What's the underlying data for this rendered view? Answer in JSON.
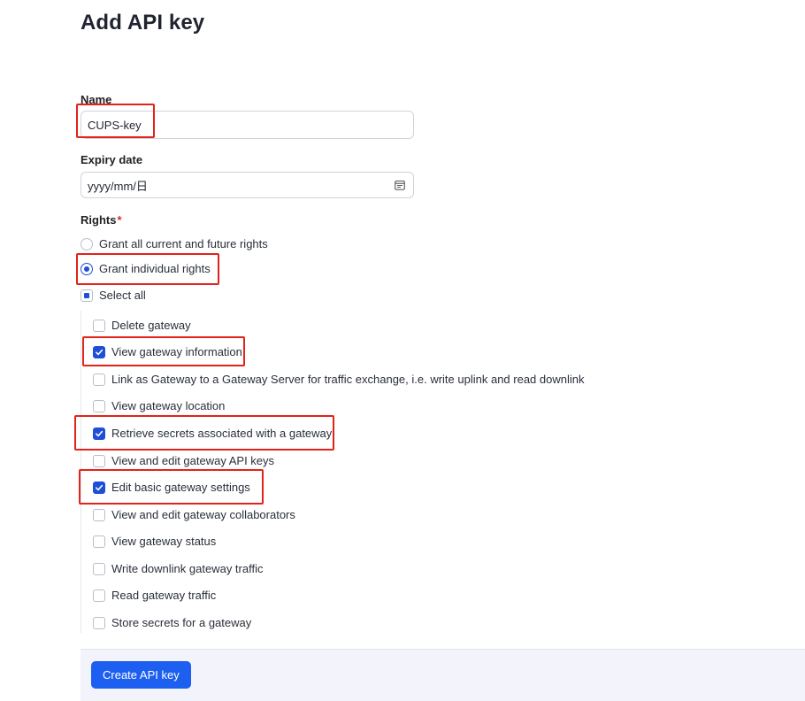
{
  "page": {
    "title": "Add API key"
  },
  "name_field": {
    "label": "Name",
    "value": "CUPS-key"
  },
  "expiry_field": {
    "label": "Expiry date",
    "placeholder": "yyyy/mm/日",
    "icon": "calendar-icon"
  },
  "rights": {
    "label": "Rights",
    "required_marker": "*",
    "options": [
      {
        "label": "Grant all current and future rights",
        "selected": false
      },
      {
        "label": "Grant individual rights",
        "selected": true
      }
    ],
    "select_all": {
      "label": "Select all",
      "state": "indeterminate"
    },
    "items": [
      {
        "label": "Delete gateway",
        "checked": false
      },
      {
        "label": "View gateway information",
        "checked": true
      },
      {
        "label": "Link as Gateway to a Gateway Server for traffic exchange, i.e. write uplink and read downlink",
        "checked": false
      },
      {
        "label": "View gateway location",
        "checked": false
      },
      {
        "label": "Retrieve secrets associated with a gateway",
        "checked": true
      },
      {
        "label": "View and edit gateway API keys",
        "checked": false
      },
      {
        "label": "Edit basic gateway settings",
        "checked": true
      },
      {
        "label": "View and edit gateway collaborators",
        "checked": false
      },
      {
        "label": "View gateway status",
        "checked": false
      },
      {
        "label": "Write downlink gateway traffic",
        "checked": false
      },
      {
        "label": "Read gateway traffic",
        "checked": false
      },
      {
        "label": "Store secrets for a gateway",
        "checked": false
      }
    ]
  },
  "footer": {
    "submit_label": "Create API key"
  },
  "colors": {
    "accent": "#1d5ff0",
    "checked": "#1f4fd6",
    "highlight": "#e2231a",
    "required": "#d32f2f"
  }
}
